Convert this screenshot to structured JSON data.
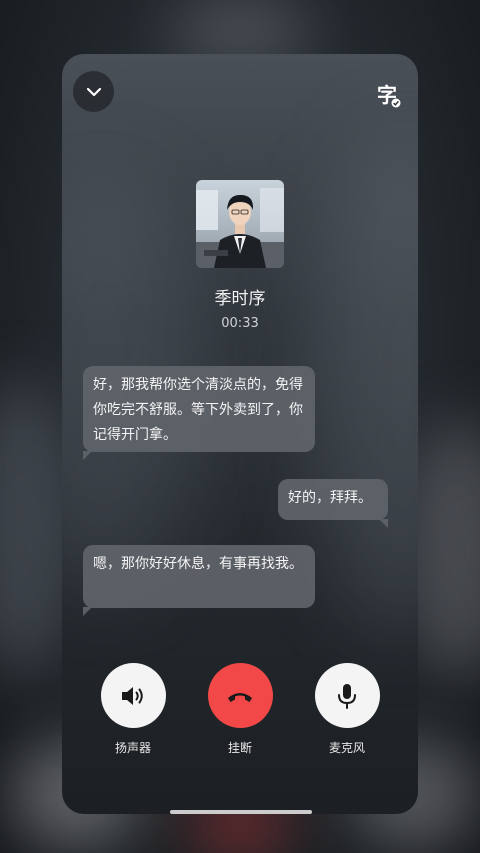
{
  "header": {
    "collapse_icon": "chevron-down-icon",
    "subtitle_glyph": "字",
    "subtitle_icon": "subtitle-toggle-icon"
  },
  "contact": {
    "name": "季时序",
    "call_duration": "00:33"
  },
  "messages": [
    {
      "side": "left",
      "text": "好，那我帮你选个清淡点的，免得你吃完不舒服。等下外卖到了，你记得开门拿。"
    },
    {
      "side": "right",
      "text": "好的，拜拜。"
    },
    {
      "side": "left",
      "text": "嗯，那你好好休息，有事再找我。"
    }
  ],
  "controls": {
    "speaker": {
      "label": "扬声器",
      "icon": "speaker-icon"
    },
    "hangup": {
      "label": "挂断",
      "icon": "hang-up-icon"
    },
    "mic": {
      "label": "麦克风",
      "icon": "microphone-icon"
    }
  },
  "colors": {
    "hangup": "#f24848",
    "control_bg": "#f4f4f4"
  }
}
